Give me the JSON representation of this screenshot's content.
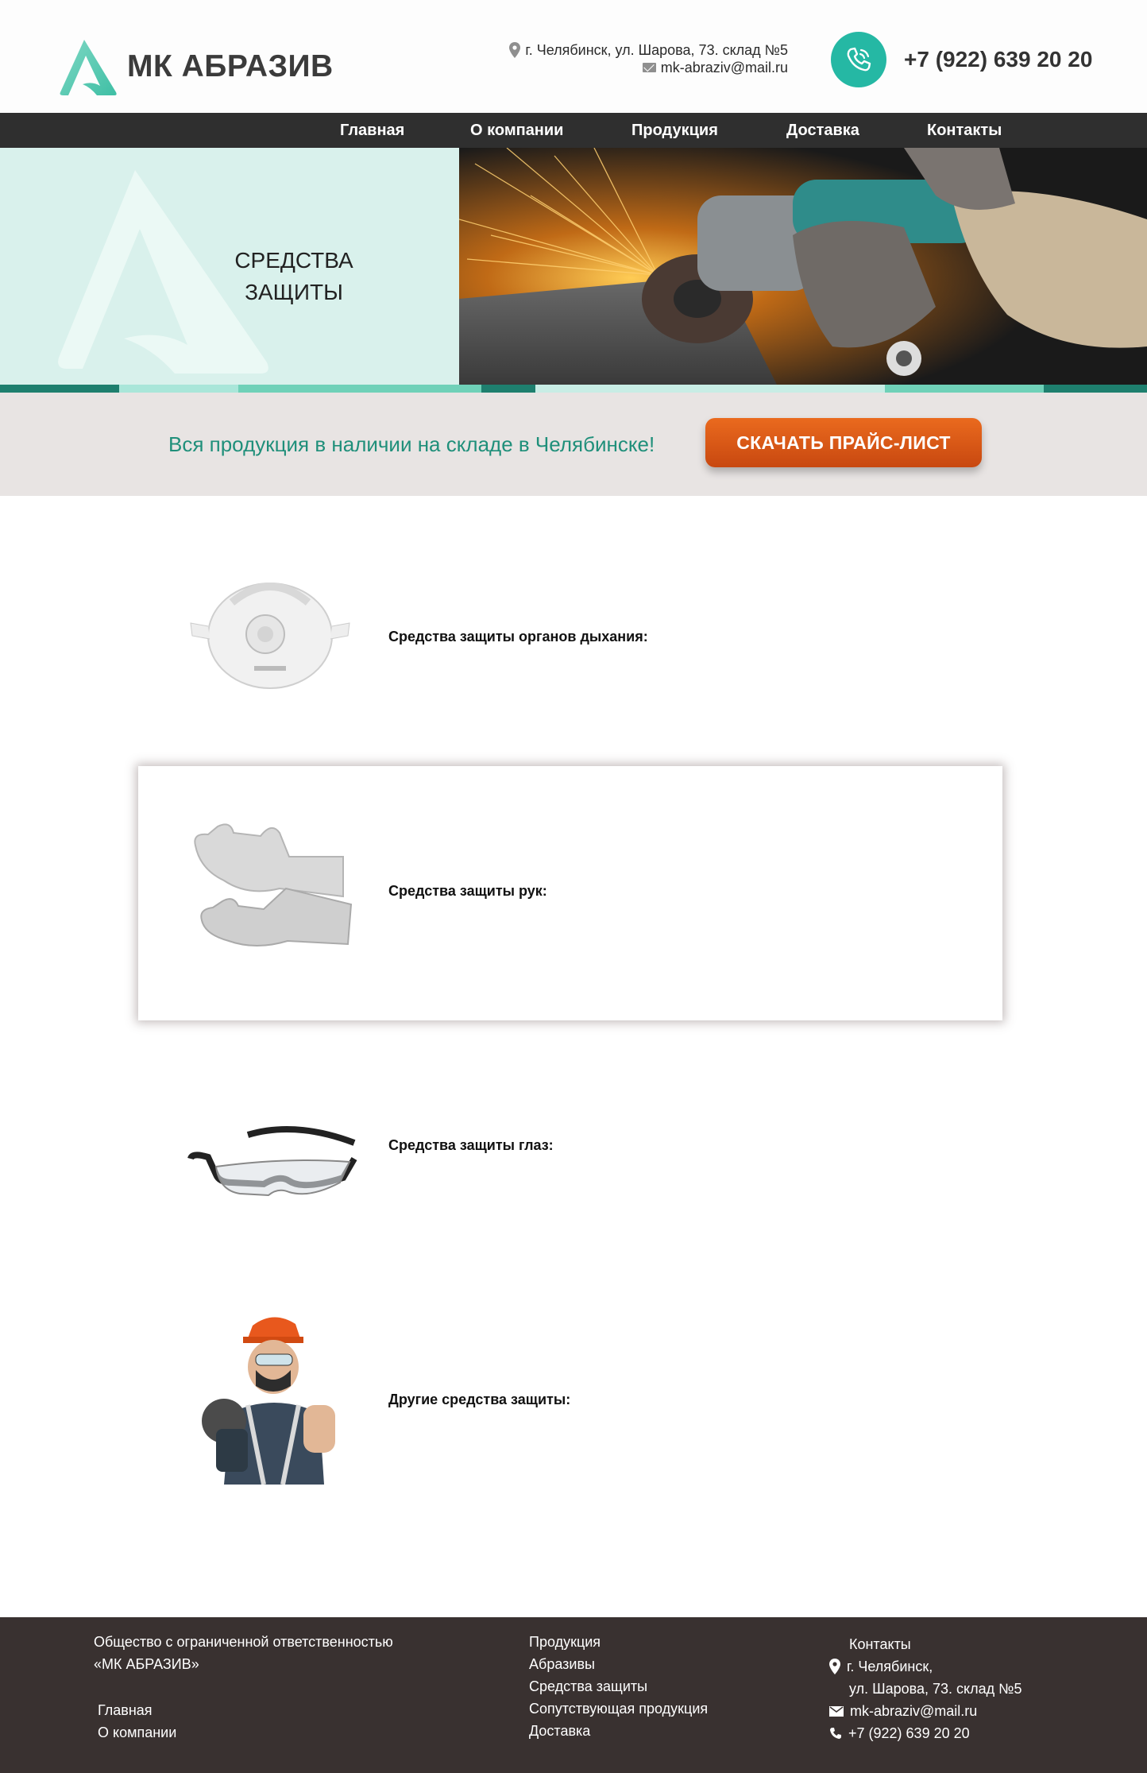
{
  "brand": {
    "name": "МК АБРАЗИВ",
    "accent": "#25b8a4",
    "dark": "#2f2f2f"
  },
  "header": {
    "address": "г. Челябинск, ул. Шарова, 73. склад №5",
    "email": "mk-abraziv@mail.ru",
    "phone": "+7 (922) 639 20 20",
    "icons": [
      "location-pin-icon",
      "mail-icon",
      "phone-icon"
    ]
  },
  "nav": {
    "items": [
      {
        "label": "Главная"
      },
      {
        "label": "О компании"
      },
      {
        "label": "Продукция"
      },
      {
        "label": "Доставка"
      },
      {
        "label": "Контакты"
      }
    ]
  },
  "banner": {
    "title_line1": "СРЕДСТВА",
    "title_line2": "ЗАЩИТЫ"
  },
  "promo": {
    "text": "Вся продукция в наличии на складе в Челябинске!",
    "button_label": "СКАЧАТЬ ПРАЙС-ЛИСТ",
    "button_color": "#e0621a"
  },
  "categories": [
    {
      "label": "Средства защиты органов дыхания:",
      "image": "respirator-mask"
    },
    {
      "label": "Средства защиты рук:",
      "image": "work-gloves"
    },
    {
      "label": "Средства защиты глаз:",
      "image": "safety-glasses"
    },
    {
      "label": "Другие средства защиты:",
      "image": "worker-with-grinder"
    }
  ],
  "footer": {
    "company_line1": "Общество с ограниченной ответственностью",
    "company_line2": "«МК АБРАЗИВ»",
    "links_left": [
      "Главная",
      "О компании"
    ],
    "products_heading": "Продукция",
    "products_links": [
      "Абразивы",
      "Средства защиты",
      "Сопутствующая продукция",
      "Доставка"
    ],
    "contacts_heading": "Контакты",
    "city": "г. Челябинск,",
    "street": "ул. Шарова, 73. склад №5",
    "email": "mk-abraziv@mail.ru",
    "phone": "+7 (922) 639 20 20"
  }
}
